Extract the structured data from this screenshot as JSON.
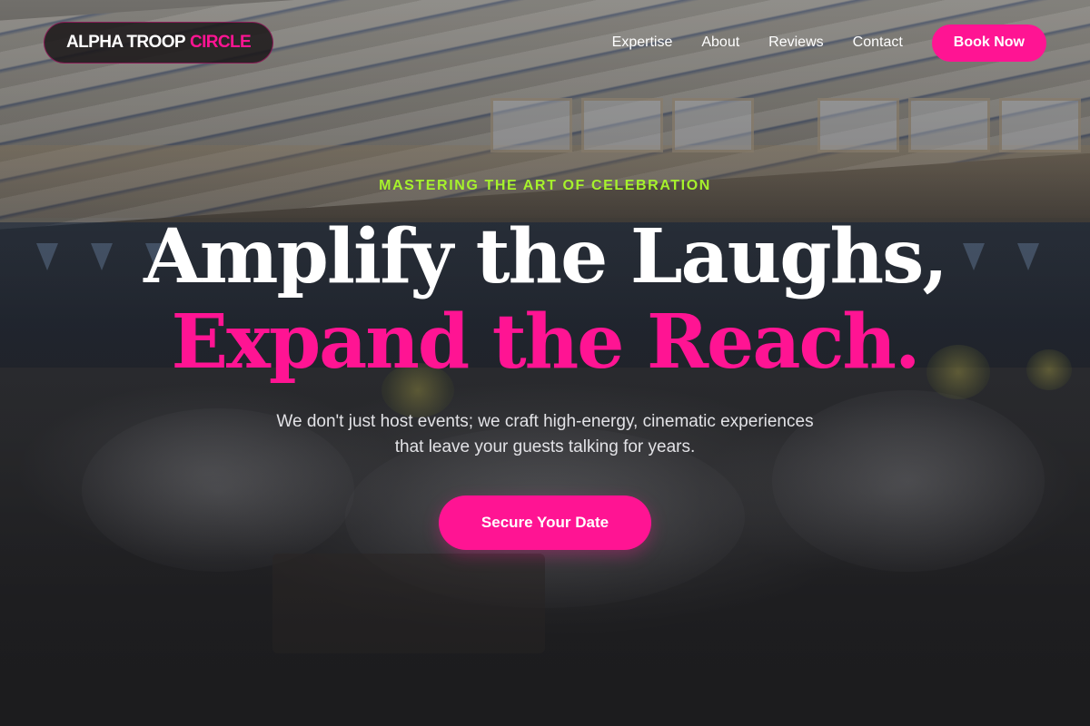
{
  "brand": {
    "name_main": "ALPHA TROOP",
    "name_accent": "CIRCLE"
  },
  "nav": {
    "links": [
      {
        "label": "Expertise"
      },
      {
        "label": "About"
      },
      {
        "label": "Reviews"
      },
      {
        "label": "Contact"
      }
    ],
    "cta_label": "Book Now"
  },
  "hero": {
    "eyebrow": "MASTERING THE ART OF CELEBRATION",
    "headline_line1": "Amplify the Laughs,",
    "headline_line2": "Expand the Reach.",
    "subtext_line1": "We don't just host events; we craft high-energy, cinematic experiences",
    "subtext_line2": "that leave your guests talking for years.",
    "cta_label": "Secure Your Date"
  },
  "colors": {
    "accent": "#ff1493",
    "eyebrow": "#a6f22c",
    "text": "#ffffff"
  }
}
